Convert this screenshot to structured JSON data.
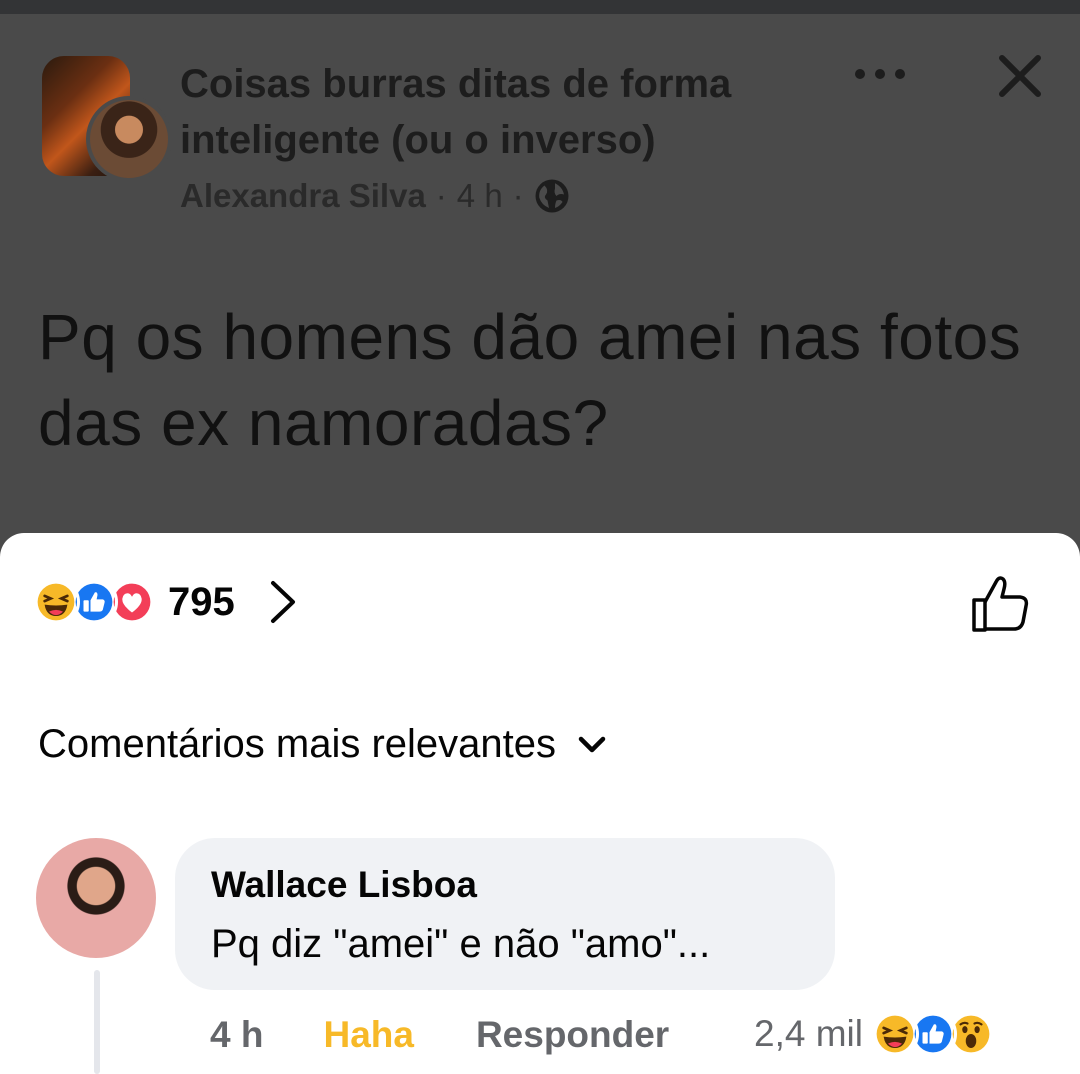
{
  "post": {
    "group_name": "Coisas burras ditas de forma inteligente (ou o inverso)",
    "author": "Alexandra Silva",
    "time": "4 h",
    "separator": "·",
    "text": "Pq os homens dão amei nas fotos das ex namoradas?"
  },
  "reactions": {
    "count": "795",
    "icons": [
      "haha-emoji-icon",
      "like-emoji-icon",
      "love-emoji-icon"
    ]
  },
  "comments_header": {
    "sort_label": "Comentários mais relevantes"
  },
  "comment": {
    "author": "Wallace Lisboa",
    "text": "Pq diz \"amei\" e não \"amo\"...",
    "time": "4 h",
    "reaction_label": "Haha",
    "reply_label": "Responder",
    "reaction_count": "2,4 mil",
    "reaction_icons": [
      "haha-emoji-icon",
      "like-emoji-icon",
      "wow-emoji-icon"
    ]
  },
  "colors": {
    "overlay": "#4a4a4a",
    "sheet": "#ffffff",
    "haha": "#f7b928",
    "like": "#1877f2",
    "love": "#f33e58",
    "bubble": "#f0f2f5"
  }
}
